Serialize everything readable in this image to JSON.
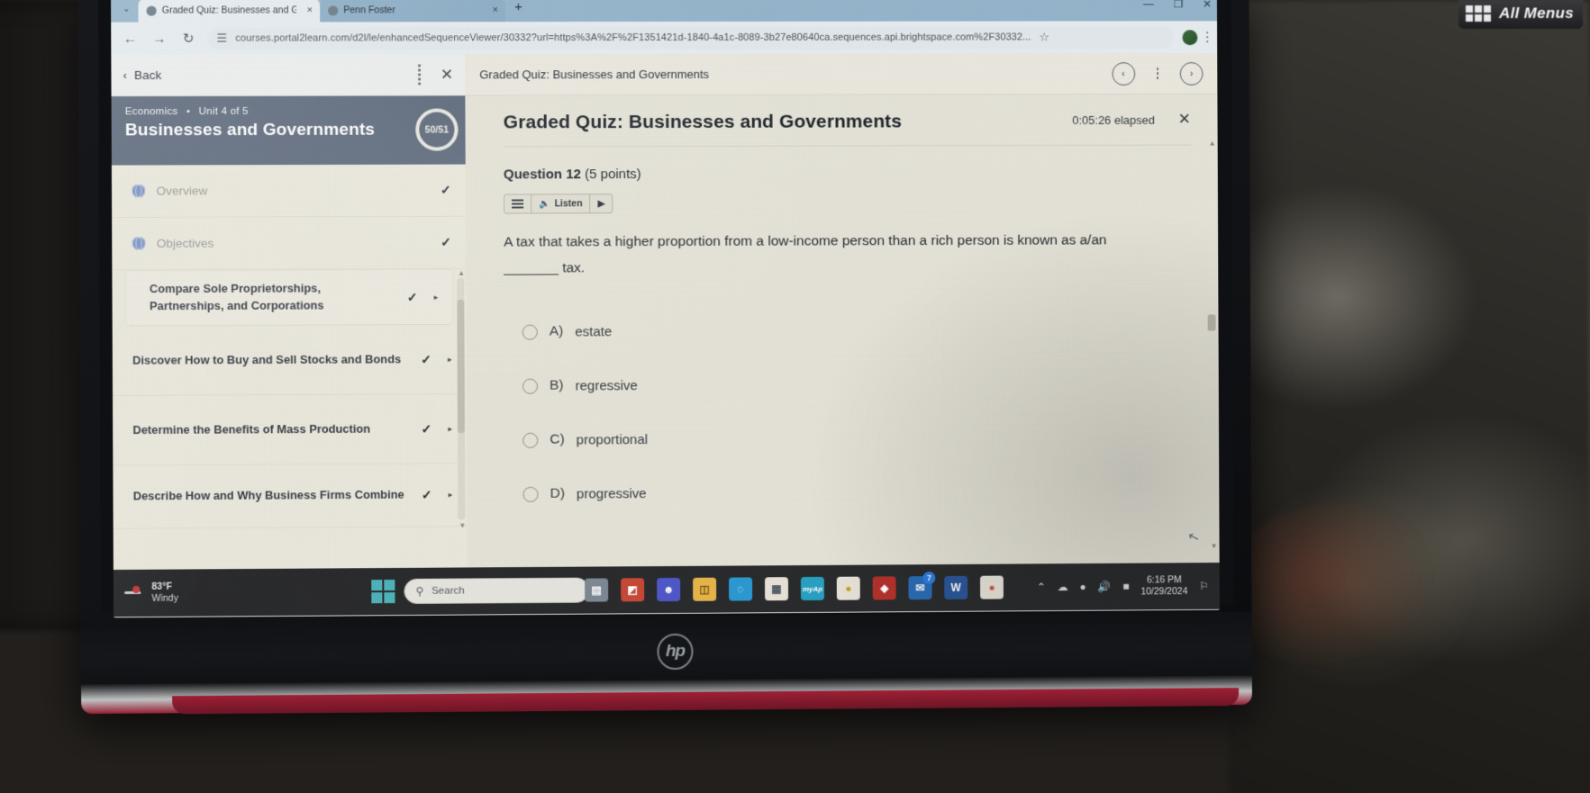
{
  "infotainment": {
    "label": "All Menus",
    "icon": "grid-icon"
  },
  "browser": {
    "tabs": [
      {
        "title": "Graded Quiz: Businesses and G",
        "close": "×",
        "active": true
      },
      {
        "title": "Penn Foster",
        "close": "×",
        "active": false
      }
    ],
    "new_tab": "+",
    "tabstrip_chevron": "⌄",
    "window_controls": {
      "minimize": "—",
      "maximize": "❐",
      "close": "✕"
    },
    "nav": {
      "back": "←",
      "forward": "→",
      "reload": "↻"
    },
    "omnibox": {
      "site_icon": "tune-icon",
      "url": "courses.portal2learn.com/d2l/le/enhancedSequenceViewer/30332?url=https%3A%2F%2F1351421d-1840-4a1c-8089-3b27e80640ca.sequences.api.brightspace.com%2F30332...",
      "bookmark_star": "☆"
    },
    "profile": "profile-avatar",
    "menu": "kebab-icon"
  },
  "sidebar": {
    "back_label": "Back",
    "back_chevron": "‹",
    "close": "✕",
    "kebab": "kebab-icon",
    "breadcrumb_course": "Economics",
    "breadcrumb_dot": "•",
    "breadcrumb_unit": "Unit 4 of 5",
    "unit_title": "Businesses and Governments",
    "progress": "50/51",
    "items": [
      {
        "label": "Overview",
        "type": "page",
        "icon": "globe-icon",
        "completed": true,
        "has_play": false
      },
      {
        "label": "Objectives",
        "type": "page",
        "icon": "globe-icon",
        "completed": true,
        "has_play": false
      },
      {
        "label": "Compare Sole Proprietorships, Partnerships, and Corporations",
        "type": "topic",
        "completed": true,
        "has_play": true
      },
      {
        "label": "Discover How to Buy and Sell Stocks and Bonds",
        "type": "topic",
        "completed": true,
        "has_play": true
      },
      {
        "label": "Determine the Benefits of Mass Production",
        "type": "topic",
        "completed": true,
        "has_play": true
      },
      {
        "label": "Describe How and Why Business Firms Combine",
        "type": "topic",
        "completed": true,
        "has_play": true
      }
    ],
    "check_glyph": "✓",
    "play_glyph": "▸",
    "scroll_up": "▲",
    "scroll_down": "▼"
  },
  "quiz": {
    "topbar_title": "Graded Quiz: Businesses and Governments",
    "prev_glyph": "‹",
    "next_glyph": "›",
    "kebab": "kebab-icon",
    "title": "Graded Quiz: Businesses and Governments",
    "timer": "0:05:26 elapsed",
    "close": "✕",
    "question_label": "Question 12",
    "question_points": "(5 points)",
    "readspeaker": {
      "menu_icon": "hamburger-icon",
      "speaker_icon": "speaker-icon",
      "listen_label": "Listen",
      "play_icon": "play-icon"
    },
    "question_text": "A tax that takes a higher proportion from a low-income person than a rich person is known as a/an _______ tax.",
    "options": [
      {
        "letter": "A)",
        "text": "estate",
        "selected": false
      },
      {
        "letter": "B)",
        "text": "regressive",
        "selected": false
      },
      {
        "letter": "C)",
        "text": "proportional",
        "selected": false
      },
      {
        "letter": "D)",
        "text": "progressive",
        "selected": false
      }
    ],
    "scroll_up": "▲",
    "scroll_down": "▼",
    "cursor": "↖"
  },
  "taskbar": {
    "weather_temp": "83°F",
    "weather_cond": "Windy",
    "start_label": "start-icon",
    "search_placeholder": "Search",
    "search_icon": "⚲",
    "apps": [
      {
        "name": "task-view",
        "glyph": "▤",
        "color": "#7e8a94"
      },
      {
        "name": "office",
        "glyph": "◩",
        "color": "#c84a38"
      },
      {
        "name": "teams",
        "glyph": "▰",
        "color": "#5059c9"
      },
      {
        "name": "file-explorer",
        "glyph": "▭",
        "color": "#e8b64c"
      },
      {
        "name": "edge",
        "glyph": "◔",
        "color": "#2d9bd4"
      },
      {
        "name": "microsoft-store",
        "glyph": "▦",
        "color": "#e8e4da"
      },
      {
        "name": "myap",
        "glyph": "myAp",
        "color": "#2aa3c4"
      },
      {
        "name": "paint",
        "glyph": "●",
        "color": "#e8e4da"
      },
      {
        "name": "firefox",
        "glyph": "◆",
        "color": "#b5332c"
      },
      {
        "name": "outlook",
        "glyph": "✉",
        "color": "#2b6cb5",
        "badge": "7"
      },
      {
        "name": "word",
        "glyph": "W",
        "color": "#2b579a"
      },
      {
        "name": "chrome",
        "glyph": "●",
        "color": "#d9534f"
      }
    ],
    "tray": {
      "chevron": "⌃",
      "onedrive": "☁",
      "wifi": "◠",
      "volume": "◁",
      "battery": "▧",
      "notifications": "○"
    },
    "clock_time": "6:16 PM",
    "clock_date": "10/29/2024"
  },
  "laptop": {
    "brand": "hp"
  }
}
